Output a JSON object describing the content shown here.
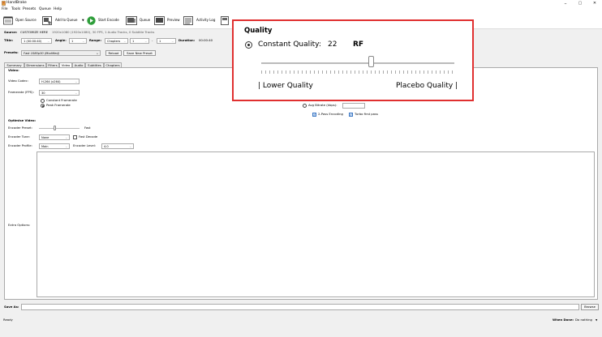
{
  "window": {
    "title": "HandBrake",
    "minimize": "–",
    "maximize": "▢",
    "close": "✕"
  },
  "menu": [
    "File",
    "Tools",
    "Presets",
    "Queue",
    "Help"
  ],
  "toolbar": {
    "open_source": "Open Source",
    "add_to_queue": "Add to Queue",
    "start_encode": "Start Encode",
    "queue": "Queue",
    "preview": "Preview",
    "activity_log": "Activity Log"
  },
  "source": {
    "label": "Source:",
    "name": "CUSTOMIZE HERE",
    "info": "1920x1080 (1920x1080), 30 FPS, 1 Audio Tracks, 0 Subtitle Tracks"
  },
  "title_row": {
    "title_label": "Title:",
    "title_value": "1 (00:00:40)",
    "angle_label": "Angle:",
    "angle_value": "1",
    "range_label": "Range:",
    "range_value": "Chapters",
    "range_start": "1",
    "range_sep": "-",
    "range_end": "1",
    "duration_label": "Duration:",
    "duration_value": "00:00:40"
  },
  "presets": {
    "label": "Presets:",
    "value": "Fast 1080p30 (Modified)",
    "reload": "Reload",
    "save_new": "Save New Preset"
  },
  "tabs": [
    "Summary",
    "Dimensions",
    "Filters",
    "Video",
    "Audio",
    "Subtitles",
    "Chapters"
  ],
  "active_tab": "Video",
  "video": {
    "section_label": "Video:",
    "codec_label": "Video Codec:",
    "codec_value": "H.264 (x264)",
    "framerate_label": "Framerate (FPS):",
    "framerate_value": "30",
    "constant_framerate": "Constant Framerate",
    "peak_framerate": "Peak Framerate",
    "avg_bitrate_label": "Avg Bitrate (kbps):",
    "two_pass": "2-Pass Encoding",
    "turbo_first_pass": "Turbo first pass"
  },
  "optimise": {
    "section_label": "Optimise Video:",
    "preset_label": "Encoder Preset:",
    "preset_value_label": "Fast",
    "tune_label": "Encoder Tune:",
    "tune_value": "None",
    "fast_decode": "Fast Decode",
    "profile_label": "Encoder Profile:",
    "profile_value": "Main",
    "level_label": "Encoder Level:",
    "level_value": "4.0"
  },
  "extra_options_label": "Extra Options:",
  "save_as": {
    "label": "Save As:",
    "value": "",
    "browse": "Browse"
  },
  "status": {
    "text": "Ready",
    "when_done_label": "When Done:",
    "when_done_value": "Do nothing"
  },
  "quality_zoom": {
    "title": "Quality",
    "constant_quality_label": "Constant Quality:",
    "value": "22",
    "unit": "RF",
    "slider_position_fraction": 0.57,
    "lower": "| Lower Quality",
    "higher": "Placebo Quality |"
  },
  "colors": {
    "highlight_border": "#e03030",
    "start_green": "#2e9e3a"
  }
}
